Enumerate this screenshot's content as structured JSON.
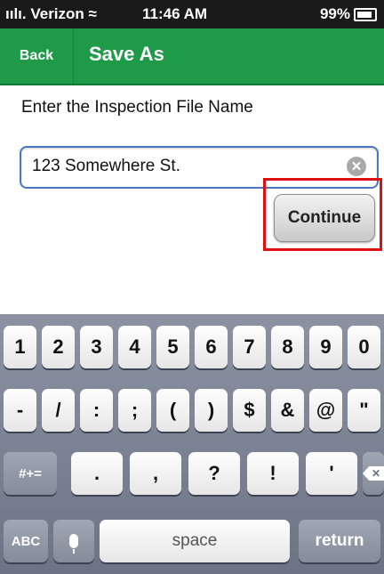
{
  "status_bar": {
    "carrier": "ıılı. Verizon ≈",
    "time": "11:46 AM",
    "battery": "99%"
  },
  "nav": {
    "back_label": "Back",
    "title": "Save As"
  },
  "form": {
    "prompt": "Enter the Inspection File Name",
    "file_name_value": "123 Somewhere St.",
    "continue_label": "Continue"
  },
  "keyboard": {
    "row1": [
      "1",
      "2",
      "3",
      "4",
      "5",
      "6",
      "7",
      "8",
      "9",
      "0"
    ],
    "row2": [
      "-",
      "/",
      ":",
      ";",
      "(",
      ")",
      "$",
      "&",
      "@",
      "\""
    ],
    "row3": {
      "mode": "#+=",
      "keys": [
        ".",
        ",",
        "?",
        "!",
        "'"
      ]
    },
    "row4": {
      "abc": "ABC",
      "space": "space",
      "return": "return"
    }
  },
  "colors": {
    "nav_green": "#1f9a49",
    "highlight_red": "#e01010",
    "field_border": "#4a76c0"
  }
}
